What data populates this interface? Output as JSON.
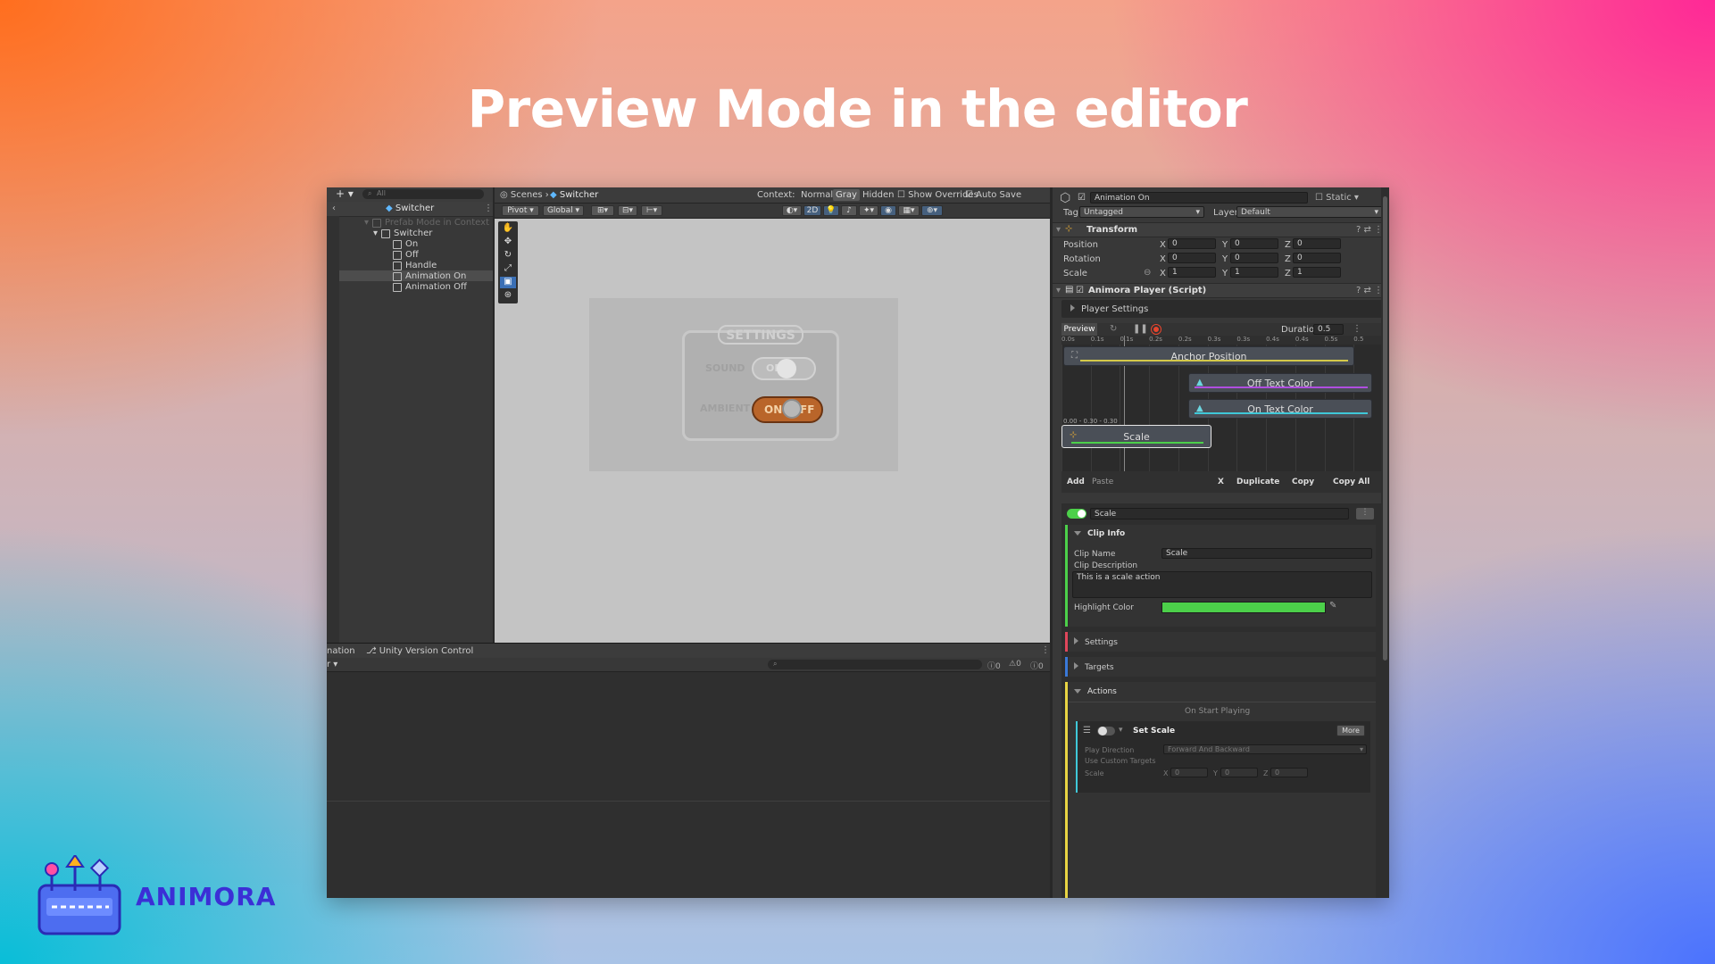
{
  "banner": {
    "title": "Preview Mode in the editor",
    "brand": "ANIMORA"
  },
  "hierarchy": {
    "search_placeholder": "All",
    "root": "Switcher",
    "prefab_mode": "Prefab Mode in Context",
    "items": [
      "Switcher",
      "On",
      "Off",
      "Handle",
      "Animation On",
      "Animation Off"
    ]
  },
  "scene": {
    "breadcrumb_scenes": "Scenes",
    "breadcrumb_switcher": "Switcher",
    "context_label": "Context:",
    "context_normal": "Normal",
    "context_gray": "Gray",
    "context_hidden": "Hidden",
    "show_overrides": "Show Overrides",
    "auto_save": "Auto Save",
    "pivot": "Pivot",
    "global": "Global",
    "mode_2d": "2D",
    "panel": {
      "settings": "SETTINGS",
      "sound": "SOUND",
      "ambient": "AMBIENT",
      "on": "ON",
      "off": "OFF",
      "off_partial": "FF",
      "off_dim": "OFF"
    }
  },
  "bottom": {
    "tab_animation": "nation",
    "tab_uvc": "Unity Version Control",
    "dropdown": "r",
    "count_info": "0",
    "count_warn": "0",
    "count_err": "0"
  },
  "inspector": {
    "object_name": "Animation On",
    "static": "Static",
    "tag_label": "Tag",
    "tag": "Untagged",
    "layer_label": "Layer",
    "layer": "Default",
    "transform": {
      "title": "Transform",
      "rows": [
        {
          "label": "Position",
          "x": "0",
          "y": "0",
          "z": "0"
        },
        {
          "label": "Rotation",
          "x": "0",
          "y": "0",
          "z": "0"
        },
        {
          "label": "Scale",
          "x": "1",
          "y": "1",
          "z": "1"
        }
      ]
    },
    "player": {
      "title": "Animora Player (Script)",
      "settings": "Player Settings",
      "preview": "Preview",
      "duration_label": "Duration",
      "duration": "0.5",
      "ticks": [
        "0.0s",
        "0.1s",
        "0.1s",
        "0.2s",
        "0.2s",
        "0.3s",
        "0.3s",
        "0.4s",
        "0.4s",
        "0.5s",
        "0.5"
      ],
      "clips": [
        "Anchor Position",
        "Off Text Color",
        "On Text Color",
        "Scale"
      ],
      "range_label": "0.00 - 0.30 - 0.30",
      "actions": {
        "add": "Add",
        "paste": "Paste",
        "x": "X",
        "duplicate": "Duplicate",
        "copy": "Copy",
        "copy_all": "Copy All"
      }
    },
    "clip": {
      "name_field": "Scale",
      "clip_info": "Clip Info",
      "clip_name_label": "Clip Name",
      "clip_name": "Scale",
      "desc_label": "Clip Description",
      "desc": "This is a scale action",
      "highlight_label": "Highlight Color",
      "settings": "Settings",
      "targets": "Targets",
      "actions": "Actions",
      "on_start": "On Start Playing",
      "set_scale": "Set Scale",
      "more": "More",
      "play_direction_label": "Play Direction",
      "play_direction": "Forward And Backward",
      "custom_targets": "Use Custom Targets",
      "scale_label": "Scale",
      "sx": "0",
      "sy": "0",
      "sz": "0"
    }
  },
  "colors": {
    "highlight": "#4cd04a",
    "record": "#e8452e",
    "accent_blue": "#3a79d8"
  }
}
